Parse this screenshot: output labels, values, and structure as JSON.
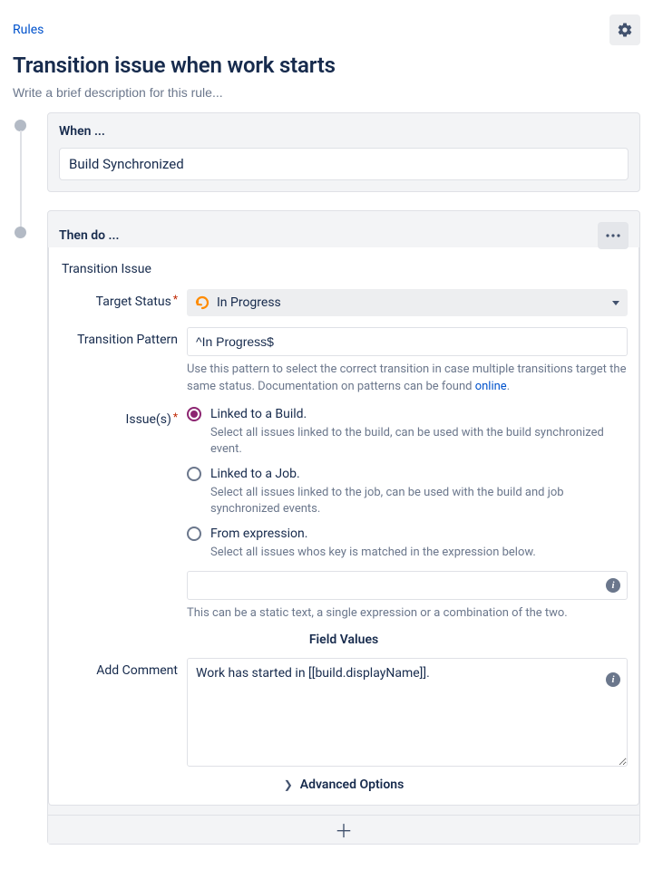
{
  "breadcrumb": {
    "label": "Rules"
  },
  "title": "Transition issue when work starts",
  "description_placeholder": "Write a brief description for this rule...",
  "when": {
    "heading": "When ...",
    "trigger": "Build Synchronized"
  },
  "then": {
    "heading": "Then do ...",
    "action_title": "Transition Issue",
    "target_status": {
      "label": "Target Status",
      "value": "In Progress"
    },
    "transition_pattern": {
      "label": "Transition Pattern",
      "value": "^In Progress$",
      "help_prefix": "Use this pattern to select the correct transition in case multiple transitions target the same status. Documentation on patterns can be found ",
      "help_link": "online",
      "help_suffix": "."
    },
    "issues": {
      "label": "Issue(s)",
      "options": [
        {
          "label": "Linked to a Build.",
          "help": "Select all issues linked to the build, can be used with the build synchronized event.",
          "selected": true
        },
        {
          "label": "Linked to a Job.",
          "help": "Select all issues linked to the job, can be used with the build and job synchronized events.",
          "selected": false
        },
        {
          "label": "From expression.",
          "help": "Select all issues whos key is matched in the expression below.",
          "selected": false
        }
      ],
      "expression_value": "",
      "expression_help": "This can be a static text, a single expression or a combination of the two."
    },
    "field_values_heading": "Field Values",
    "add_comment": {
      "label": "Add Comment",
      "value": "Work has started in [[build.displayName]]."
    },
    "advanced_label": "Advanced Options"
  }
}
